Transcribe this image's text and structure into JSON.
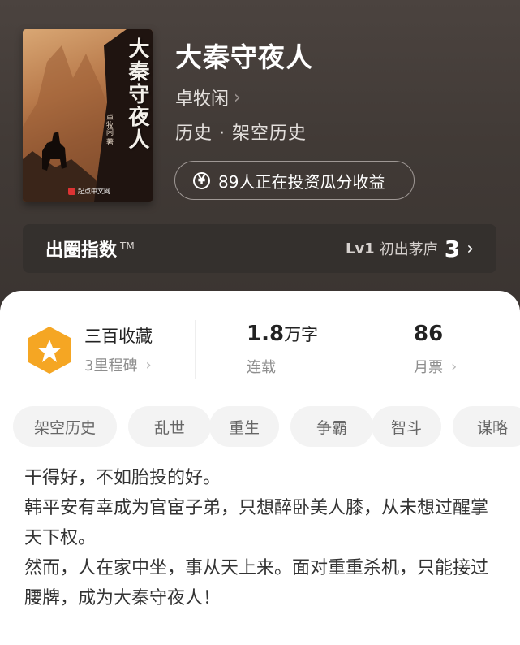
{
  "book": {
    "title": "大秦守夜人",
    "author": "卓牧闲",
    "category": "历史 · 架空历史",
    "cover": {
      "title": "大秦守夜人",
      "author": "卓牧闲 著",
      "publisher": "起点中文网"
    }
  },
  "invest": {
    "icon": "yen-icon",
    "label": "89人正在投资瓜分收益"
  },
  "circle_index": {
    "title": "出圈指数",
    "tm": "TM",
    "level": "Lv1",
    "level_name": "初出茅庐",
    "value": "3"
  },
  "stats": {
    "collection_title": "三百收藏",
    "collection_sub": "3里程碑",
    "words_value": "1.8",
    "words_unit": "万字",
    "status": "连载",
    "monthly_votes": "86",
    "monthly_label": "月票"
  },
  "tags": [
    "架空历史",
    "乱世",
    "重生",
    "争霸",
    "智斗",
    "谋略"
  ],
  "intro": [
    "干得好，不如胎投的好。",
    "韩平安有幸成为官宦子弟，只想醉卧美人膝，从未想过醒掌天下权。",
    "然而，人在家中坐，事从天上来。面对重重杀机，只能接过腰牌，成为大秦守夜人！"
  ],
  "colors": {
    "header_bg": "#433c38",
    "badge": "#f5a623",
    "tag_bg": "#f3f3f3"
  }
}
